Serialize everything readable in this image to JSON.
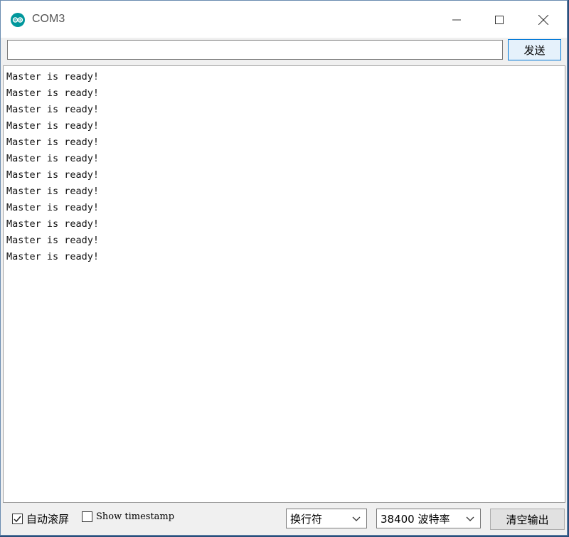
{
  "window": {
    "title": "COM3",
    "icon": "arduino-icon",
    "controls": [
      "minimize-icon",
      "maximize-icon",
      "close-icon"
    ]
  },
  "send_row": {
    "input_value": "",
    "send_label": "发送"
  },
  "output": {
    "lines": [
      "Master is ready!",
      "Master is ready!",
      "Master is ready!",
      "Master is ready!",
      "Master is ready!",
      "Master is ready!",
      "Master is ready!",
      "Master is ready!",
      "Master is ready!",
      "Master is ready!",
      "Master is ready!",
      "Master is ready!"
    ]
  },
  "footer": {
    "autoscroll_label": "自动滚屏",
    "autoscroll_checked": true,
    "timestamp_label": "Show timestamp",
    "timestamp_checked": false,
    "line_ending": "换行符",
    "baud_rate": "38400 波特率",
    "clear_label": "清空输出"
  },
  "colors": {
    "accent": "#0078d7",
    "arduino": "#00979c"
  }
}
